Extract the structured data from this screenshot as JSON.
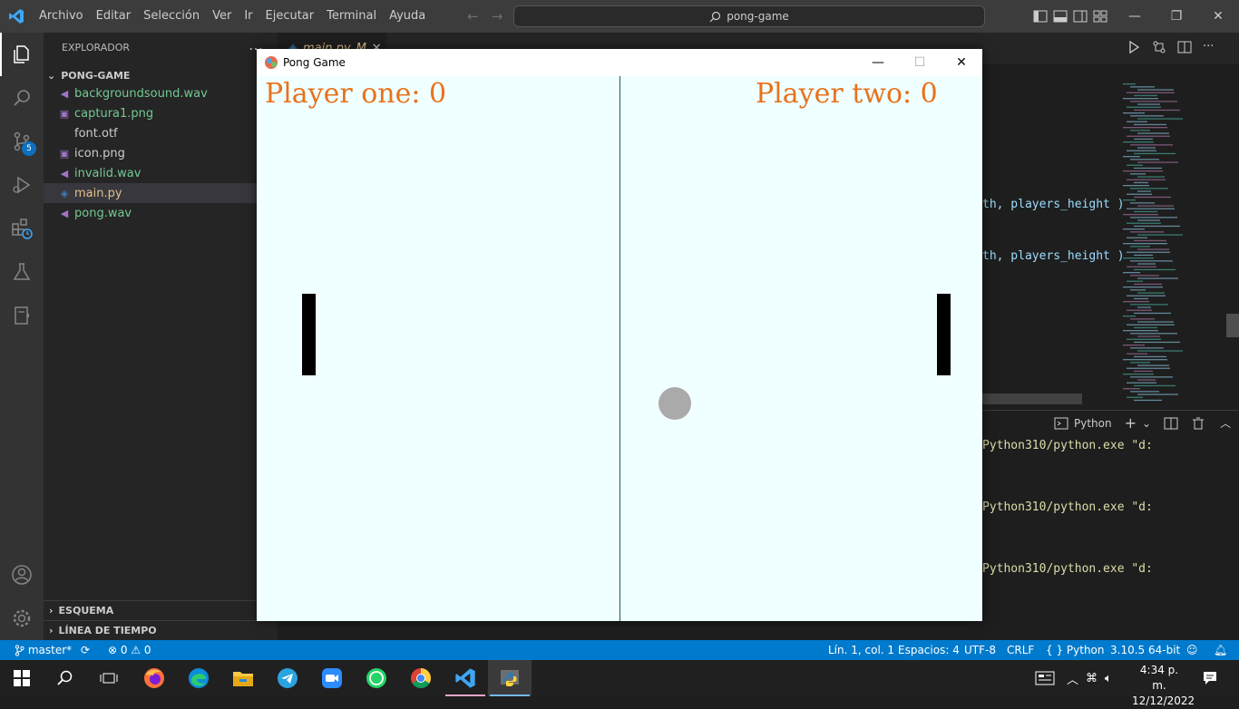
{
  "titlebar": {
    "menu": [
      "Archivo",
      "Editar",
      "Selección",
      "Ver",
      "Ir",
      "Ejecutar",
      "Terminal",
      "Ayuda"
    ],
    "search": "pong-game"
  },
  "sidebar": {
    "header": "EXPLORADOR",
    "folder": "PONG-GAME",
    "files": [
      {
        "name": "backgroundsound.wav",
        "color": "#73c991",
        "icon": "audio-file-icon"
      },
      {
        "name": "captura1.png",
        "color": "#73c991",
        "icon": "image-file-icon"
      },
      {
        "name": "font.otf",
        "color": "#cccccc",
        "icon": "text-file-icon"
      },
      {
        "name": "icon.png",
        "color": "#cccccc",
        "icon": "image-file-icon"
      },
      {
        "name": "invalid.wav",
        "color": "#73c991",
        "icon": "audio-file-icon"
      },
      {
        "name": "main.py",
        "color": "#e2c08d",
        "icon": "python-file-icon",
        "modified": "M"
      },
      {
        "name": "pong.wav",
        "color": "#73c991",
        "icon": "audio-file-icon"
      }
    ],
    "outline": "ESQUEMA",
    "timeline": "LÍNEA DE TIEMPO"
  },
  "tab": {
    "label": "main.py",
    "mod": "M"
  },
  "editor": {
    "lines": [
      "th, players_height )",
      "th, players_height )"
    ]
  },
  "activity": {
    "scm_badge": "5"
  },
  "panel": {
    "terminal_label": "Python",
    "lines": [
      "Python310/python.exe \"d:",
      "Python310/python.exe \"d:",
      "Python310/python.exe \"d:"
    ]
  },
  "statusbar": {
    "branch": "master*",
    "problems": "0",
    "warnings": "0",
    "position": "Lín. 1, col. 1",
    "spaces": "Espacios: 4",
    "encoding": "UTF-8",
    "eol": "CRLF",
    "language": "Python",
    "interpreter": "3.10.5 64-bit"
  },
  "taskbar": {
    "time": "4:34 p. m.",
    "date": "12/12/2022"
  },
  "pong": {
    "title": "Pong Game",
    "score_one_label": "Player one: 0",
    "score_two_label": "Player two: 0",
    "colors": {
      "background": "#f0ffff",
      "score": "#e8721c",
      "net": "#1f5f5f",
      "paddle": "#000000",
      "ball": "#aaaaaa"
    }
  }
}
